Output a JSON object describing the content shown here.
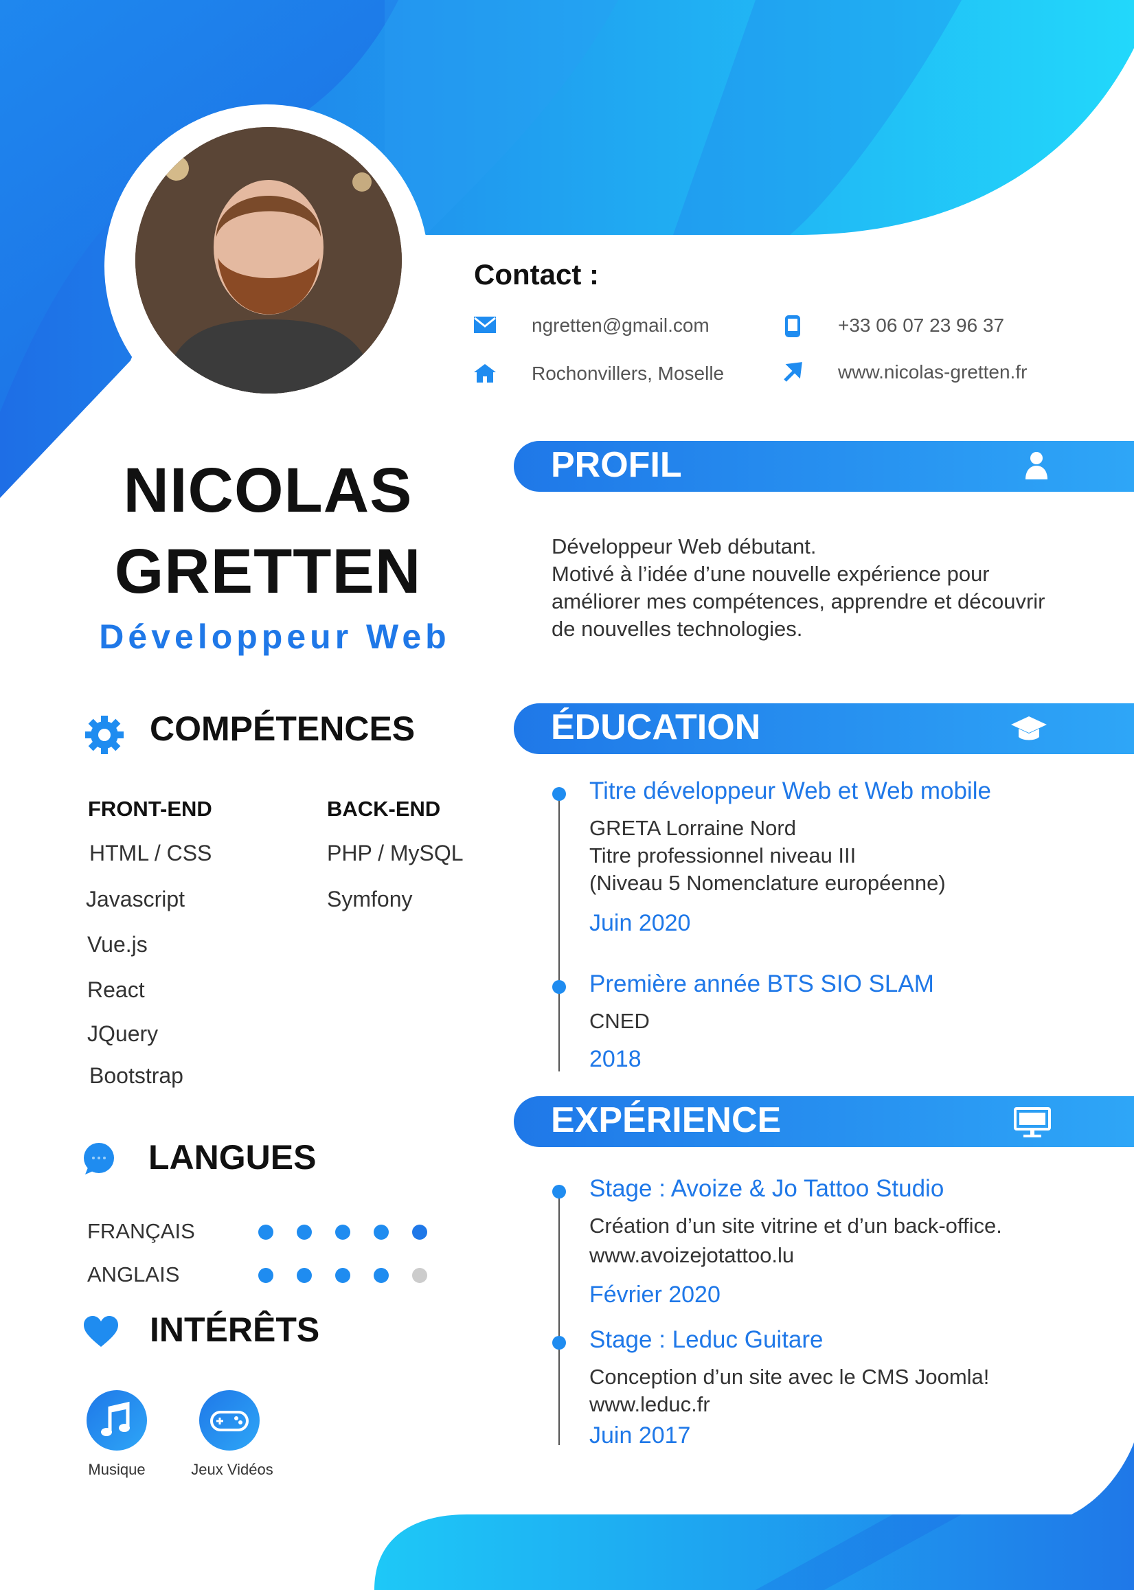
{
  "contact": {
    "title": "Contact :",
    "email": "ngretten@gmail.com",
    "phone": "+33 06 07 23 96 37",
    "address": "Rochonvillers, Moselle",
    "website": "www.nicolas-gretten.fr"
  },
  "header": {
    "first_name": "NICOLAS",
    "last_name": "GRETTEN",
    "job_title": "Développeur Web"
  },
  "skills": {
    "title": "COMPÉTENCES",
    "front_title": "FRONT-END",
    "back_title": "BACK-END",
    "front": [
      "HTML / CSS",
      "Javascript",
      "Vue.js",
      "React",
      "JQuery",
      "Bootstrap"
    ],
    "back": [
      "PHP / MySQL",
      "Symfony"
    ]
  },
  "languages": {
    "title": "LANGUES",
    "items": [
      {
        "name": "FRANÇAIS",
        "level": 5,
        "max": 5
      },
      {
        "name": "ANGLAIS",
        "level": 4,
        "max": 5
      }
    ]
  },
  "interests": {
    "title": "INTÉRÊTS",
    "items": [
      {
        "label": "Musique",
        "icon": "music-note-icon"
      },
      {
        "label": "Jeux Vidéos",
        "icon": "gamepad-icon"
      }
    ]
  },
  "profile": {
    "title": "PROFIL",
    "lines": [
      "Développeur Web débutant.",
      "Motivé à l’idée d’une nouvelle expérience pour",
      "améliorer mes compétences, apprendre et découvrir",
      "de nouvelles technologies."
    ]
  },
  "education": {
    "title": "ÉDUCATION",
    "items": [
      {
        "title": "Titre développeur Web et Web mobile",
        "lines": [
          "GRETA Lorraine Nord",
          "Titre professionnel niveau III",
          "(Niveau 5 Nomenclature européenne)"
        ],
        "date": "Juin 2020"
      },
      {
        "title": "Première année BTS SIO SLAM",
        "lines": [
          "CNED"
        ],
        "date": "2018"
      }
    ]
  },
  "experience": {
    "title": "EXPÉRIENCE",
    "items": [
      {
        "title": "Stage : Avoize & Jo Tattoo Studio",
        "lines": [
          "Création d’un site vitrine et d’un back-office.",
          "www.avoizejotattoo.lu"
        ],
        "date": "Février 2020"
      },
      {
        "title": "Stage : Leduc Guitare",
        "lines": [
          "Conception d’un site avec le CMS Joomla!",
          "www.leduc.fr"
        ],
        "date": "Juin 2017"
      }
    ]
  },
  "colors": {
    "accent": "#1f78e8",
    "accent_light": "#2ea6f7",
    "dot_empty": "#cccccc"
  }
}
